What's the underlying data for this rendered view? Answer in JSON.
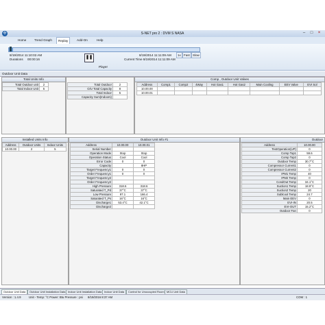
{
  "window": {
    "title": "S-NET pro 2 : DVM S NASA",
    "min": "–",
    "max": "□",
    "close": "×"
  },
  "menu": [
    "Home",
    "Trend Graph",
    "Replay",
    "Add-On",
    "Help"
  ],
  "replay": {
    "start_label": "8/19/2014 11:10:02 AM",
    "duration_label": "Durations",
    "duration_value": "00:00:16",
    "end_label": "8/19/2014 11:11:09 AM",
    "current_label": "Current Time 8/19/2014 11:11:09 AM",
    "player_label": "Player",
    "pause_symbol": "❚❚",
    "progress": 0.02,
    "speeds": [
      "1x",
      "Fast",
      "Slow"
    ]
  },
  "outdoor_unit_data_title": "Outdoor Unit Data",
  "total_units": {
    "title": "Total Units Info",
    "rows": [
      [
        "Total Outdoor unit",
        "2"
      ],
      [
        "Total Indoor Unit",
        "5"
      ]
    ]
  },
  "total_outdoor": {
    "rows": [
      [
        "Total Outdoor",
        "2"
      ],
      [
        "O/U Total Capacity",
        "8"
      ],
      [
        "Total Indoor",
        "5"
      ],
      [
        "Capacity Sum(Indoors)",
        ""
      ]
    ]
  },
  "comp": {
    "title": "Comp , Outdoor Unit Valves",
    "headers": [
      "Address",
      "Comp1",
      "Comp2",
      "4Way",
      "Hot Gas1",
      "Hot Gas2",
      "Main Cooling",
      "EEV Valve",
      "EVI Sol"
    ],
    "rows": [
      [
        "10.00.00",
        "",
        "",
        "",
        "",
        "",
        "",
        "",
        ""
      ],
      [
        "10.00.01",
        "",
        "",
        "",
        "",
        "",
        "",
        "",
        ""
      ]
    ]
  },
  "installed": {
    "title": "Installed Units Info",
    "headers": [
      "Address",
      "Outdoor Units",
      "Indoor Units"
    ],
    "rows": [
      [
        "10.00.00",
        "2",
        "5"
      ]
    ]
  },
  "ou1": {
    "title": "Outdoor Unit Info #1",
    "headers": [
      "Address",
      "10.00.00",
      "10.00.01"
    ],
    "rows": [
      [
        "Serial Number",
        "",
        ""
      ],
      [
        "Operation Mode",
        "Stop",
        "Stop"
      ],
      [
        "Operation Status",
        "Cool",
        "Cool"
      ],
      [
        "Error Code",
        "0",
        "0"
      ],
      [
        "Capacity",
        "",
        "8HP"
      ],
      [
        "Target Frequency1",
        "0",
        "0"
      ],
      [
        "Order Frequency1",
        "0",
        "0"
      ],
      [
        "Target Frequency2",
        "",
        ""
      ],
      [
        "Order Frequency2",
        "",
        ""
      ],
      [
        "High Pressure",
        "318.6",
        "318.6"
      ],
      [
        "Saturated T_Pd",
        "37°C",
        "37°C"
      ],
      [
        "Low Pressure",
        "97.1",
        "166.4"
      ],
      [
        "Saturated T_Ps",
        "16°C",
        "16°C"
      ],
      [
        "Discharge1",
        "53.4°C",
        "42.1°C"
      ],
      [
        "Discharge2",
        "",
        ""
      ]
    ]
  },
  "outdoor_right": {
    "title": "Outdoor",
    "headers": [
      "Address",
      "10.00.00"
    ],
    "rows": [
      [
        "TestOperation(UP)",
        "0"
      ],
      [
        "Comp Top1",
        "59.6"
      ],
      [
        "Comp Top2",
        "0"
      ],
      [
        "Outdoor Temp",
        "30.7°C"
      ],
      [
        "Compressor Current1",
        "0"
      ],
      [
        "Compressor Current2",
        "0"
      ],
      [
        "IPM1 Temp",
        "40"
      ],
      [
        "IPM2 Temp",
        "0"
      ],
      [
        "CondOut Temp",
        "34.1°C"
      ],
      [
        "Suction1 Temp",
        "18.9°C"
      ],
      [
        "Suction2 Temp",
        "20"
      ],
      [
        "Sublcool Temp",
        "24.7"
      ],
      [
        "Main EEV",
        "0"
      ],
      [
        "EVI-IN",
        "20.5"
      ],
      [
        "EVI-OUT",
        "15.2°C"
      ],
      [
        "Outdoor Fan",
        "0"
      ]
    ]
  },
  "tabs": [
    "Outdoor Unit Data",
    "Outdoor Unit Installation Data",
    "Indoor Unit Installation Data",
    "Indoor Unit Data",
    "Control for Unoccupied Room",
    "MCU Unit Data"
  ],
  "status": {
    "version": "Version : 1.4.9",
    "units": "Unit - Temp: °C    Power: Btu    Pressure : psi",
    "datetime": "8/19/2016    8:37 AM",
    "com": "COM : 1"
  }
}
